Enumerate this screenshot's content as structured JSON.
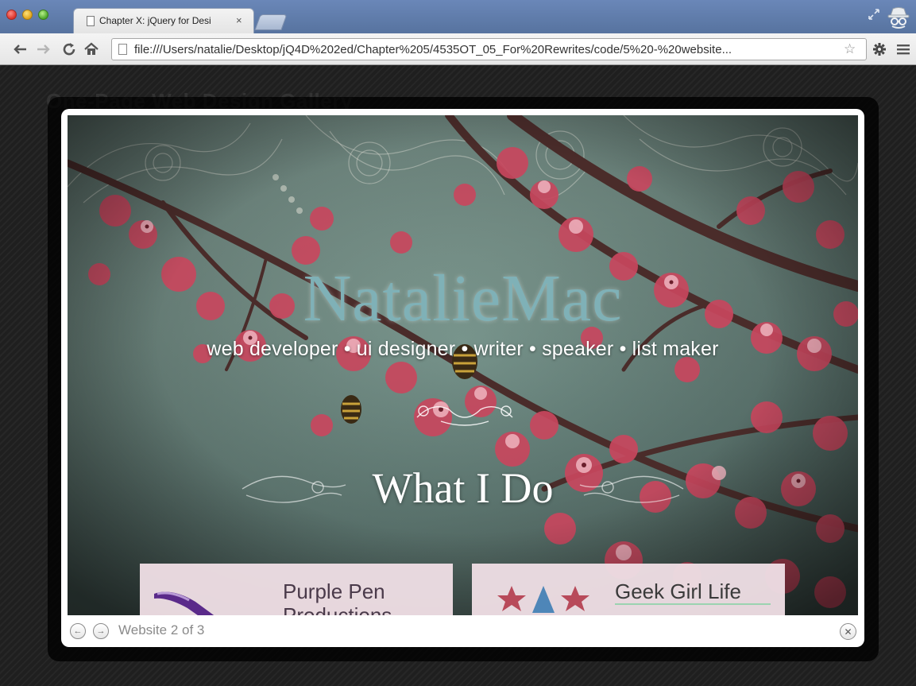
{
  "browser": {
    "tab_title": "Chapter X: jQuery for Desi",
    "tab_close": "×",
    "url": "file:///Users/natalie/Desktop/jQ4D%202ed/Chapter%205/4535OT_05_For%20Rewrites/code/5%20-%20website...",
    "icons": {
      "back": "back-arrow-icon",
      "forward": "forward-arrow-icon",
      "reload": "reload-icon",
      "home": "home-icon",
      "star": "bookmark-star-icon",
      "settings": "wrench-gear-icon",
      "menu": "hamburger-menu-icon",
      "incognito": "incognito-icon"
    }
  },
  "page": {
    "heading": "One-Page Web Design Gallery"
  },
  "lightbox": {
    "site": {
      "title": "NatalieMac",
      "tagline": "web developer • ui designer • writer • speaker • list maker",
      "section_heading": "What I Do",
      "cards": [
        {
          "title": "Purple Pen Productions"
        },
        {
          "title": "Geek Girl Life"
        }
      ]
    },
    "footer": {
      "prev_symbol": "←",
      "next_symbol": "→",
      "caption": "Website 2 of 3",
      "close_symbol": "✕"
    }
  },
  "colors": {
    "title_teal": "#7fb1b7",
    "blossom_pink": "#c8475e",
    "tabbar_blue": "#5f7cab",
    "card_pink": "#eedee4",
    "underline_green": "#9bd3b0"
  }
}
